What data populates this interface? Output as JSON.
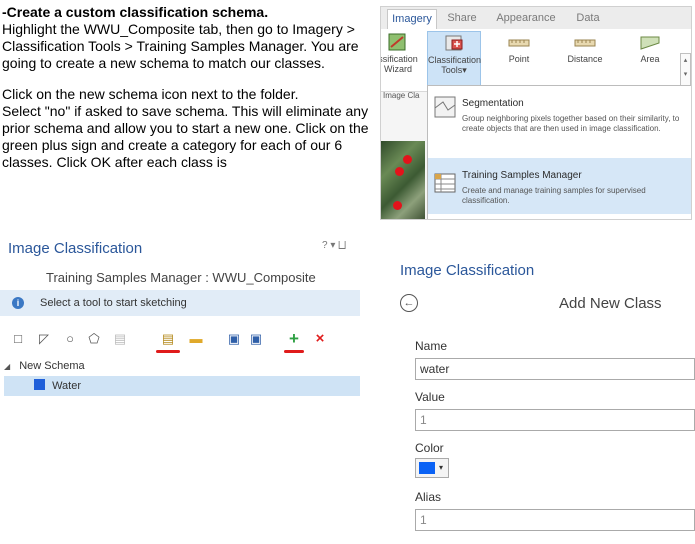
{
  "instructions": {
    "title": "-Create a custom classification schema.",
    "p1": "Highlight the WWU_Composite tab, then go to Imagery > Classification Tools > Training Samples Manager. You are going to create a new schema to match our classes.",
    "p2": "Click on the new schema icon next to the folder.",
    "p3": "Select \"no\" if asked to save schema. This will eliminate any prior schema and allow you to start a new one. Click on the green plus sign and create a category for each of our 6 classes. Click OK after each class is"
  },
  "ribbon": {
    "tabs": [
      "Imagery",
      "Share",
      "Appearance",
      "Data"
    ],
    "tools": {
      "wizard": [
        "ssification",
        "Wizard"
      ],
      "classification_tools": [
        "Classification",
        "Tools▾"
      ],
      "point": "Point",
      "distance": "Distance",
      "area": "Area"
    },
    "group_label": "Image Cla",
    "scroll": [
      "▴",
      "▾",
      "⌄"
    ],
    "dropdown": {
      "segmentation": {
        "title": "Segmentation",
        "desc": "Group neighboring pixels together based on their similarity, to create objects that are then used in image classification."
      },
      "training": {
        "title": "Training Samples Manager",
        "desc": "Create and manage training samples for supervised classification."
      }
    }
  },
  "tsm_panel": {
    "title": "Image Classification",
    "controls": "? ▾ ⨆",
    "subtitle": "Training Samples Manager : WWU_Composite",
    "info": "Select a tool to start sketching",
    "info_icon": "i",
    "schema": "New Schema",
    "class_row": "Water",
    "tools": {
      "rect": "□",
      "poly": "◸",
      "circle": "○",
      "free": "⬠",
      "new_schema": "▤",
      "open": "▬",
      "save": "▣",
      "saveas": "▣",
      "add": "+",
      "remove": "×"
    },
    "colors": {
      "add": "#2ea043",
      "remove": "#e01b1b"
    }
  },
  "anc_panel": {
    "title": "Image Classification",
    "subtitle": "Add New Class",
    "back": "←",
    "name_label": "Name",
    "name_value": "water",
    "value_label": "Value",
    "value_value": "1",
    "color_label": "Color",
    "color_value": "#0a62f5",
    "alias_label": "Alias",
    "alias_value": "1",
    "color_arrow": "▾"
  }
}
